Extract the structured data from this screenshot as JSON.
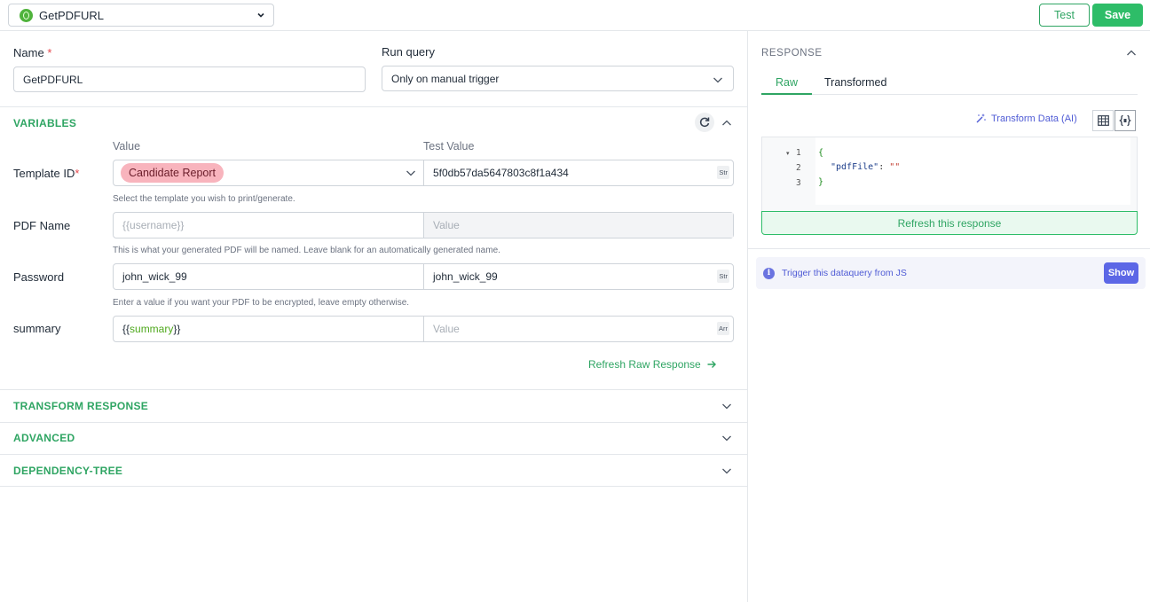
{
  "header": {
    "query_name": "GetPDFURL",
    "test_label": "Test",
    "save_label": "Save"
  },
  "form": {
    "name_label": "Name",
    "required_mark": "*",
    "name_value": "GetPDFURL",
    "run_query_label": "Run query",
    "run_query_value": "Only on manual trigger"
  },
  "variables": {
    "title": "VARIABLES",
    "value_header": "Value",
    "test_value_header": "Test Value",
    "rows": [
      {
        "label": "Template ID",
        "required": "*",
        "value": "Candidate Report",
        "test_value": "5f0db57da5647803c8f1a434",
        "type": "Str",
        "hint": "Select the template you wish to print/generate."
      },
      {
        "label": "PDF Name",
        "value_placeholder": "{{username}}",
        "test_value_placeholder": "Value",
        "hint": "This is what your generated PDF will be named. Leave blank for an automatically generated name."
      },
      {
        "label": "Password",
        "value": "john_wick_99",
        "test_value": "john_wick_99",
        "type": "Str",
        "hint": "Enter a value if you want your PDF to be encrypted, leave empty otherwise."
      },
      {
        "label": "summary",
        "value_open": "{{",
        "value_var": "summary",
        "value_close": "}}",
        "test_value_placeholder": "Value",
        "type": "Arr"
      }
    ],
    "refresh_link": "Refresh Raw Response"
  },
  "sections": {
    "transform": "TRANSFORM RESPONSE",
    "advanced": "ADVANCED",
    "dependency": "DEPENDENCY-TREE"
  },
  "response": {
    "title": "RESPONSE",
    "tabs": [
      "Raw",
      "Transformed"
    ],
    "transform_ai": "Transform Data (AI)",
    "code_lines": [
      {
        "n": "1",
        "text": "{"
      },
      {
        "n": "2",
        "key": "\"pdfFile\"",
        "sep": ": ",
        "val": "\"\""
      },
      {
        "n": "3",
        "text": "}"
      }
    ],
    "refresh_response": "Refresh this response",
    "trigger_text": "Trigger this dataquery from JS",
    "show_label": "Show"
  },
  "colors": {
    "accent": "#2fa563",
    "primary_button": "#2ebd68",
    "chip_bg": "#f8b4bd",
    "info": "#5c67e6"
  }
}
